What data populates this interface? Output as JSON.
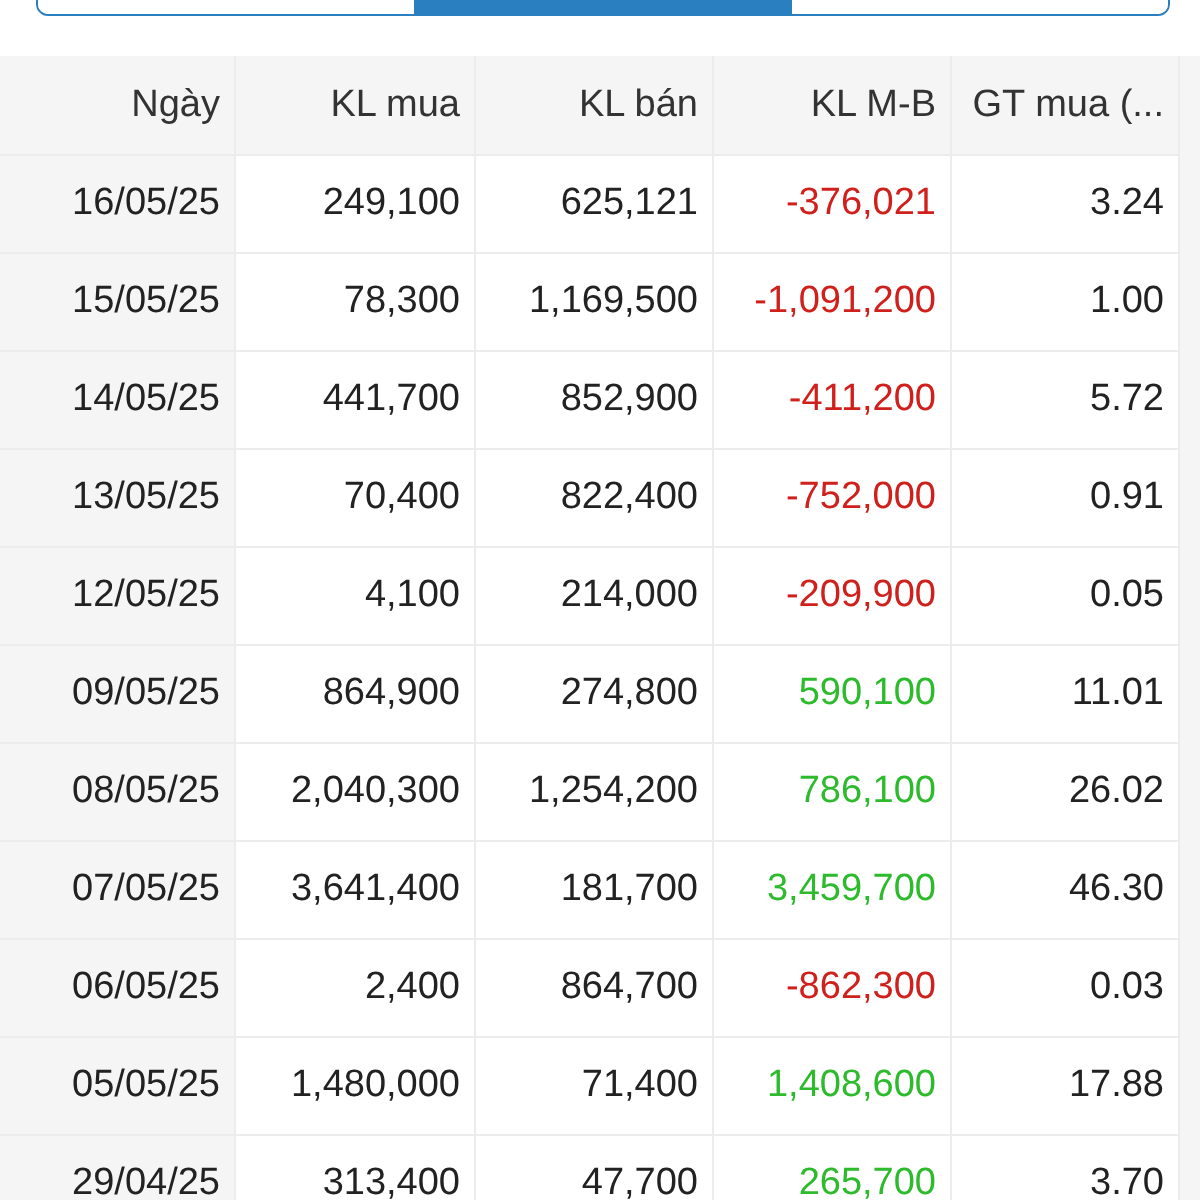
{
  "segments": [
    {
      "selected": false
    },
    {
      "selected": true
    },
    {
      "selected": false
    }
  ],
  "table": {
    "columns": [
      "Ngày",
      "KL mua",
      "KL bán",
      "KL M-B",
      "GT mua (..."
    ],
    "rows": [
      {
        "date": "16/05/25",
        "buy": "249,100",
        "sell": "625,121",
        "net": {
          "text": "-376,021",
          "color": "#d0201c"
        },
        "value": "3.24"
      },
      {
        "date": "15/05/25",
        "buy": "78,300",
        "sell": "1,169,500",
        "net": {
          "text": "-1,091,200",
          "color": "#d0201c"
        },
        "value": "1.00"
      },
      {
        "date": "14/05/25",
        "buy": "441,700",
        "sell": "852,900",
        "net": {
          "text": "-411,200",
          "color": "#d0201c"
        },
        "value": "5.72"
      },
      {
        "date": "13/05/25",
        "buy": "70,400",
        "sell": "822,400",
        "net": {
          "text": "-752,000",
          "color": "#d0201c"
        },
        "value": "0.91"
      },
      {
        "date": "12/05/25",
        "buy": "4,100",
        "sell": "214,000",
        "net": {
          "text": "-209,900",
          "color": "#d0201c"
        },
        "value": "0.05"
      },
      {
        "date": "09/05/25",
        "buy": "864,900",
        "sell": "274,800",
        "net": {
          "text": "590,100",
          "color": "#2dbb2d"
        },
        "value": "11.01"
      },
      {
        "date": "08/05/25",
        "buy": "2,040,300",
        "sell": "1,254,200",
        "net": {
          "text": "786,100",
          "color": "#2dbb2d"
        },
        "value": "26.02"
      },
      {
        "date": "07/05/25",
        "buy": "3,641,400",
        "sell": "181,700",
        "net": {
          "text": "3,459,700",
          "color": "#2dbb2d"
        },
        "value": "46.30"
      },
      {
        "date": "06/05/25",
        "buy": "2,400",
        "sell": "864,700",
        "net": {
          "text": "-862,300",
          "color": "#d0201c"
        },
        "value": "0.03"
      },
      {
        "date": "05/05/25",
        "buy": "1,480,000",
        "sell": "71,400",
        "net": {
          "text": "1,408,600",
          "color": "#2dbb2d"
        },
        "value": "17.88"
      },
      {
        "date": "29/04/25",
        "buy": "313,400",
        "sell": "47,700",
        "net": {
          "text": "265,700",
          "color": "#2dbb2d"
        },
        "value": "3.70"
      }
    ]
  }
}
